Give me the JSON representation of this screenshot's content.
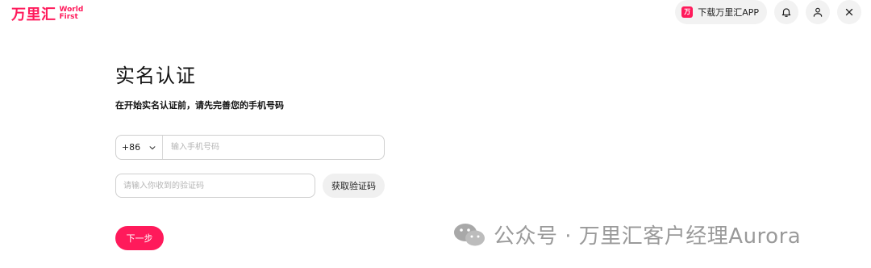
{
  "brand": {
    "name_cn": "万里汇",
    "name_en_line1": "World",
    "name_en_line2": "First",
    "color": "#ff1a5b"
  },
  "header": {
    "download_app_label": "下载万里汇APP",
    "app_icon_text": "万",
    "icons": [
      "bell-icon",
      "user-icon",
      "close-icon"
    ]
  },
  "main": {
    "title": "实名认证",
    "subtitle": "在开始实名认证前，请先完善您的手机号码",
    "country_code": "+86",
    "phone_placeholder": "输入手机号码",
    "code_placeholder": "请输入你收到的验证码",
    "get_code_label": "获取验证码",
    "next_label": "下一步"
  },
  "watermark": {
    "text": "公众号 · 万里汇客户经理Aurora",
    "icon": "wechat-icon"
  },
  "colors": {
    "accent": "#ff1a5b",
    "button_gray": "#f0f0f0",
    "border": "#cfcfcf"
  }
}
